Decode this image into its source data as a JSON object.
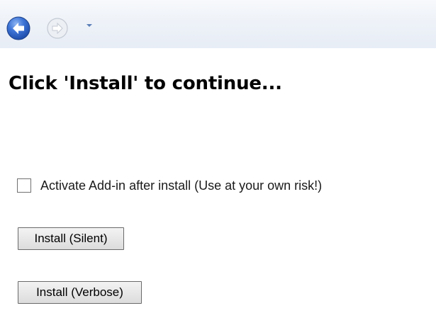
{
  "navbar": {
    "back_icon": "back-arrow-icon",
    "forward_icon": "forward-arrow-icon",
    "dropdown_icon": "chevron-down-icon",
    "colors": {
      "back_circle": "#2b62c8",
      "forward_circle": "#e6e9ef",
      "bar_bg": "#eef2f8"
    }
  },
  "main": {
    "heading": "Click 'Install' to continue...",
    "checkbox": {
      "label": "Activate Add-in after install (Use at your own risk!)",
      "checked": false
    },
    "buttons": {
      "install_silent": "Install (Silent)",
      "install_verbose": "Install (Verbose)"
    }
  }
}
